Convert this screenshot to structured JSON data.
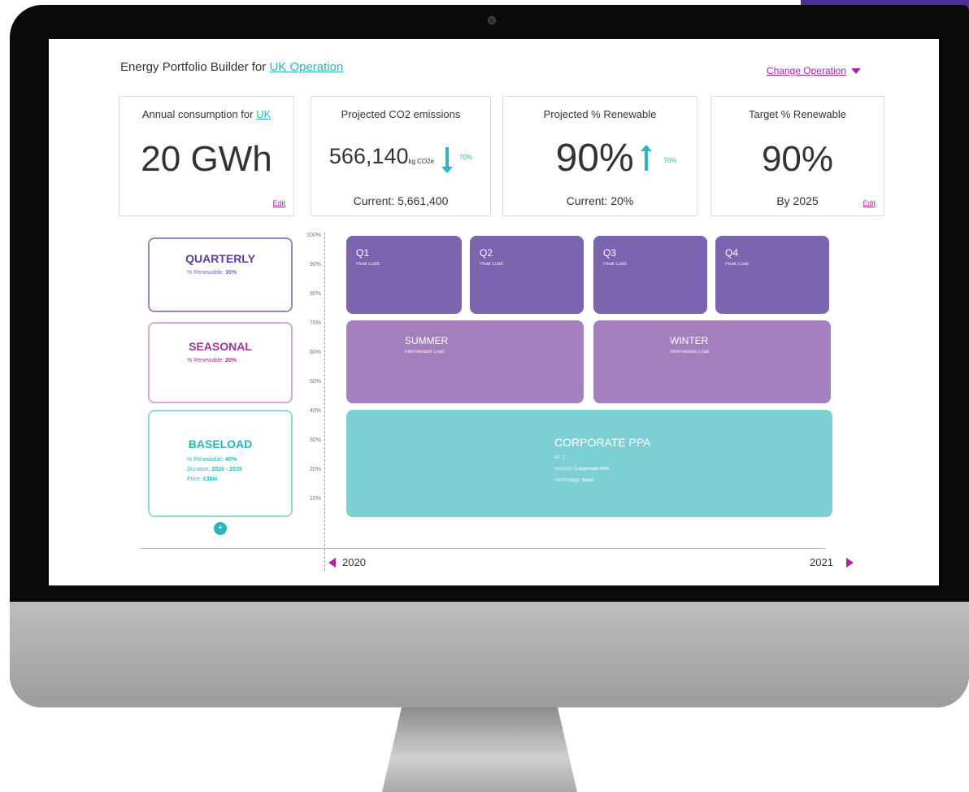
{
  "header": {
    "title_prefix": "Energy Portfolio Builder for",
    "operation": "UK Operation",
    "change_operation": "Change Operation"
  },
  "kpis": {
    "consumption": {
      "label_prefix": "Annual consumption for",
      "label_link": "UK",
      "value": "20 GWh",
      "edit": "Edit"
    },
    "emissions": {
      "label": "Projected CO2 emissions",
      "value": "566,140",
      "unit": "kg CO2e",
      "change": "70%",
      "current": "Current: 5,661,400"
    },
    "projected_renewable": {
      "label": "Projected % Renewable",
      "value": "90%",
      "change": "70%",
      "current": "Current: 20%"
    },
    "target_renewable": {
      "label": "Target % Renewable",
      "value": "90%",
      "by": "By 2025",
      "edit": "Edit"
    }
  },
  "categories": {
    "quarterly": {
      "title": "QUARTERLY",
      "desc_label": "% Renewable:",
      "desc_value": "30%"
    },
    "seasonal": {
      "title": "SEASONAL",
      "desc_label": "% Renewable:",
      "desc_value": "20%"
    },
    "baseload": {
      "title": "BASELOAD",
      "renew_label": "% Renewable:",
      "renew_value": "40%",
      "duration_label": "Duration:",
      "duration_value": "2020 - 2035",
      "price_label": "Price:",
      "price_value": "£30m"
    },
    "add": "+"
  },
  "y_axis": [
    "100%",
    "90%",
    "80%",
    "70%",
    "60%",
    "50%",
    "40%",
    "30%",
    "20%",
    "10%"
  ],
  "blocks": {
    "quarters": [
      {
        "title": "Q1",
        "sub": "Peak Load"
      },
      {
        "title": "Q2",
        "sub": "Peak Load"
      },
      {
        "title": "Q3",
        "sub": "Peak Load"
      },
      {
        "title": "Q4",
        "sub": "Peak Load"
      }
    ],
    "summer": {
      "title": "SUMMER",
      "sub": "Intermediate Load"
    },
    "winter": {
      "title": "WINTER",
      "sub": "Intermediate Load"
    },
    "ppa": {
      "title": "CORPORATE PPA",
      "id": "ID: 2",
      "solution_label": "Solution:",
      "solution_value": "Corporate PPA",
      "tech_label": "Technology:",
      "tech_value": "Solar"
    }
  },
  "timeline": {
    "start": "2020",
    "end": "2021"
  },
  "colors": {
    "teal": "#2bb5bd",
    "magenta": "#b0259e",
    "purple": "#7b64b0",
    "lavender": "#a47fbd",
    "ppa": "#7ccfd3"
  }
}
